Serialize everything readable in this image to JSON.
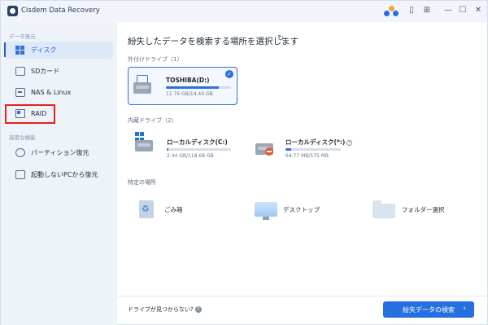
{
  "titlebar": {
    "app_title": "Cisdem Data Recovery",
    "icons": [
      "avatar-icon",
      "file-icon",
      "cart-icon",
      "minimize-icon",
      "maximize-icon",
      "close-icon"
    ]
  },
  "sidebar": {
    "section_data": "データ復元",
    "section_advanced": "高度な機能",
    "items": [
      {
        "label": "ディスク",
        "icon": "disk-grid-icon",
        "active": true
      },
      {
        "label": "SDカード",
        "icon": "sd-card-icon",
        "active": false
      },
      {
        "label": "NAS & Linux",
        "icon": "nas-icon",
        "active": false
      },
      {
        "label": "RAID",
        "icon": "raid-icon",
        "active": false
      },
      {
        "label": "パーティション復元",
        "icon": "partition-icon",
        "active": false
      },
      {
        "label": "起動しないPCから復元",
        "icon": "boot-pc-icon",
        "active": false
      }
    ],
    "highlight_color": "#e2231a"
  },
  "main": {
    "title": "紛失したデータを検索する場所を選択します",
    "external": {
      "label": "外付けドライブ（1）",
      "drives": [
        {
          "name": "TOSHIBA(D:)",
          "size": "11.76 GB/14.44 GB",
          "used_fraction": 0.81,
          "selected": true
        }
      ]
    },
    "internal": {
      "label": "内蔵ドライブ（2）",
      "drives": [
        {
          "name": "ローカルディスク(C:)",
          "size": "2.44 GB/118.68 GB",
          "used_fraction": 0.02
        },
        {
          "name": "ローカルディスク(*:)",
          "size": "64.77 MB/575 MB",
          "used_fraction": 0.11,
          "help": "?"
        }
      ]
    },
    "locations": {
      "label": "特定の場所",
      "items": [
        {
          "label": "ごみ箱",
          "icon": "recycle-bin-icon"
        },
        {
          "label": "デスクトップ",
          "icon": "desktop-icon"
        },
        {
          "label": "フォルダー選択",
          "icon": "folder-icon"
        }
      ]
    }
  },
  "footer": {
    "no_drive_text": "ドライブが見つからない?",
    "help_mark": "?",
    "search_button": "紛失データの検索",
    "search_arrow": "›"
  },
  "colors": {
    "accent": "#2570e0",
    "sidebar_bg": "#eef3fa"
  }
}
